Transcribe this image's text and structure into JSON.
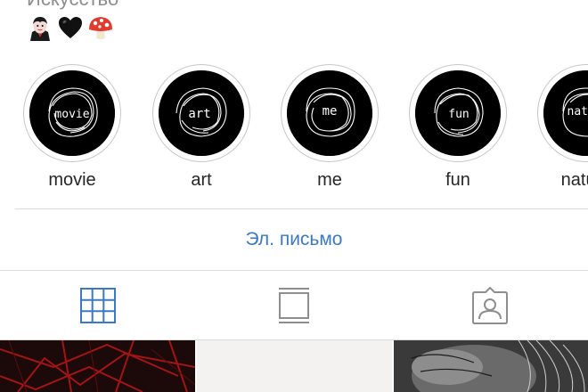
{
  "profile": {
    "category": "Искусство",
    "emoji": [
      "vampire-emoji",
      "black-heart-emoji",
      "mushroom-emoji"
    ]
  },
  "highlights": [
    {
      "cover_text": "movie",
      "label": "movie"
    },
    {
      "cover_text": "art",
      "label": "art"
    },
    {
      "cover_text": "me",
      "label": "me"
    },
    {
      "cover_text": "fun",
      "label": "fun"
    },
    {
      "cover_text": "nature",
      "label": "nature"
    }
  ],
  "contact": {
    "email_label": "Эл. письмо"
  },
  "tabs": [
    {
      "icon": "grid-icon",
      "active": true
    },
    {
      "icon": "feed-icon",
      "active": false
    },
    {
      "icon": "tagged-icon",
      "active": false
    }
  ],
  "colors": {
    "accent": "#3b79c4",
    "inactive_icon": "#8e8e8e",
    "divider": "#dbdbdb"
  },
  "posts": [
    {
      "thumb": "red-branches-photo"
    },
    {
      "thumb": "white-photo"
    },
    {
      "thumb": "bw-portrait-photo"
    }
  ]
}
